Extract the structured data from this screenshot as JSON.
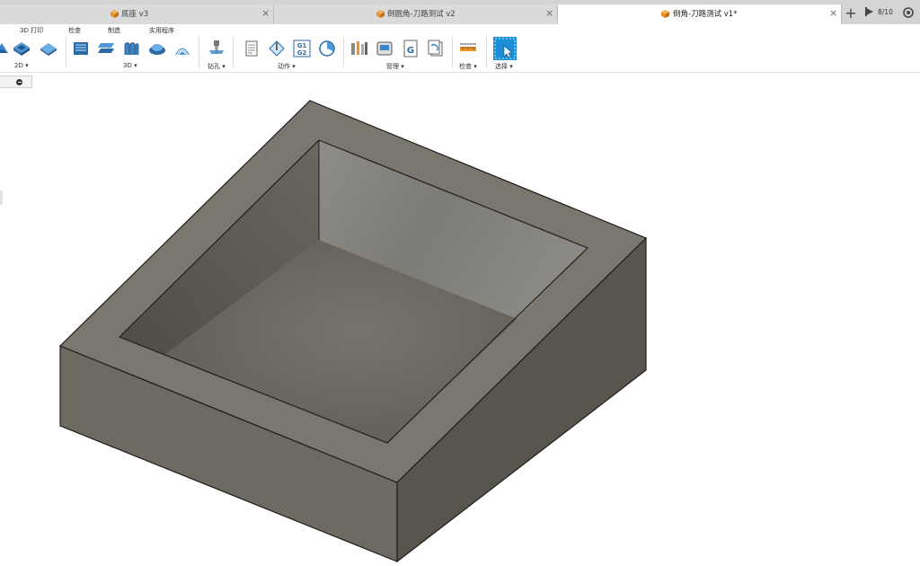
{
  "tabs": [
    {
      "label": "底座 v3",
      "active": false
    },
    {
      "label": "倒圆角-刀路测试 v2",
      "active": false
    },
    {
      "label": "倒角-刀路测试 v1*",
      "active": true
    }
  ],
  "tab_close_glyph": "×",
  "new_tab_glyph": "+",
  "jobs_status": "8/10",
  "ribbon": {
    "tab_row": [
      "3D 打印",
      "检查",
      "制造",
      "实用程序"
    ],
    "groups": [
      {
        "label": "2D ▾",
        "icons": [
          "2d-contour-icon",
          "2d-pocket-icon",
          "2d-face-icon"
        ]
      },
      {
        "label": "3D ▾",
        "icons": [
          "3d-adaptive-clearing-icon",
          "3d-pocket-clearing-icon",
          "3d-steep-shallow-icon",
          "3d-parallel-icon",
          "3d-scallop-icon"
        ]
      },
      {
        "label": "钻孔 ▾",
        "icons": [
          "drill-icon"
        ]
      },
      {
        "label": "动作 ▾",
        "icons": [
          "setup-sheet-icon",
          "simulate-icon",
          "post-process-g1g2-icon",
          "process-time-icon"
        ]
      },
      {
        "label": "管理 ▾",
        "icons": [
          "tool-library-icon",
          "machine-library-icon",
          "post-library-icon",
          "template-library-icon"
        ]
      },
      {
        "label": "检查 ▾",
        "icons": [
          "measure-icon"
        ]
      },
      {
        "label": "选择 ▾",
        "icons": [
          "select-icon"
        ]
      }
    ]
  },
  "colors": {
    "tabbar": "#d4d4d4",
    "accent_orange": "#e8912d",
    "accent_blue": "#1b8fd6",
    "model_top": "#7b776e",
    "model_left": "#6e6a62",
    "model_right": "#58554e",
    "model_floor": "#6d6a61",
    "model_wall": "#75736e"
  }
}
